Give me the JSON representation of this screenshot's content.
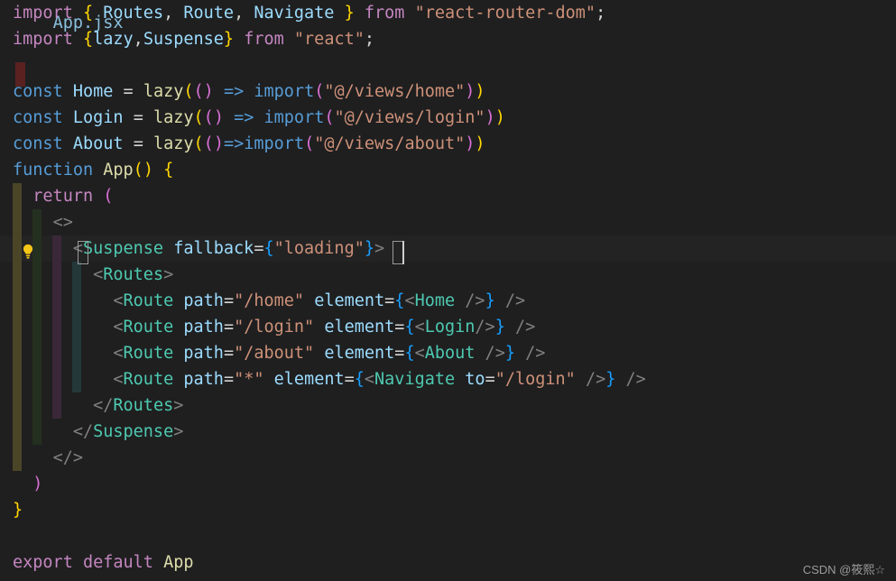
{
  "editor": {
    "language": "jsx",
    "theme": "dark-modern",
    "background_color": "#1f1f20",
    "current_line_color": "#232324",
    "cursor_line_index": 10,
    "cursor_column_after": ">"
  },
  "clipped_top_line": "App.jsx",
  "quickfix": {
    "icon": "lightbulb-icon",
    "title": "Show Code Actions",
    "line_index": 10
  },
  "code_lines": [
    {
      "index": 0,
      "indent": 0,
      "tokens": [
        {
          "t": "import",
          "c": "kw"
        },
        {
          "t": " ",
          "c": "punct"
        },
        {
          "t": "{",
          "c": "br1"
        },
        {
          "t": " ",
          "c": "punct"
        },
        {
          "t": "Routes",
          "c": "ident"
        },
        {
          "t": ",",
          "c": "punct"
        },
        {
          "t": " ",
          "c": "punct"
        },
        {
          "t": "Route",
          "c": "ident"
        },
        {
          "t": ",",
          "c": "punct"
        },
        {
          "t": " ",
          "c": "punct"
        },
        {
          "t": "Navigate",
          "c": "ident"
        },
        {
          "t": " ",
          "c": "punct"
        },
        {
          "t": "}",
          "c": "br1"
        },
        {
          "t": " ",
          "c": "punct"
        },
        {
          "t": "from",
          "c": "kw"
        },
        {
          "t": " ",
          "c": "punct"
        },
        {
          "t": "\"react-router-dom\"",
          "c": "str"
        },
        {
          "t": ";",
          "c": "punct"
        }
      ]
    },
    {
      "index": 1,
      "indent": 0,
      "tokens": [
        {
          "t": "import",
          "c": "kw"
        },
        {
          "t": " ",
          "c": "punct"
        },
        {
          "t": "{",
          "c": "br1"
        },
        {
          "t": "lazy",
          "c": "ident"
        },
        {
          "t": ",",
          "c": "punct"
        },
        {
          "t": "Suspense",
          "c": "ident"
        },
        {
          "t": "}",
          "c": "br1"
        },
        {
          "t": " ",
          "c": "punct"
        },
        {
          "t": "from",
          "c": "kw"
        },
        {
          "t": " ",
          "c": "punct"
        },
        {
          "t": "\"react\"",
          "c": "str"
        },
        {
          "t": ";",
          "c": "punct"
        }
      ]
    },
    {
      "index": 2,
      "indent": 0,
      "tokens": []
    },
    {
      "index": 3,
      "indent": 0,
      "tokens": [
        {
          "t": "const",
          "c": "kw2"
        },
        {
          "t": " ",
          "c": "punct"
        },
        {
          "t": "Home",
          "c": "ident"
        },
        {
          "t": " ",
          "c": "punct"
        },
        {
          "t": "=",
          "c": "op"
        },
        {
          "t": " ",
          "c": "punct"
        },
        {
          "t": "lazy",
          "c": "fn"
        },
        {
          "t": "(",
          "c": "br1"
        },
        {
          "t": "(",
          "c": "br2"
        },
        {
          "t": ")",
          "c": "br2"
        },
        {
          "t": " ",
          "c": "punct"
        },
        {
          "t": "=>",
          "c": "arrow"
        },
        {
          "t": " ",
          "c": "punct"
        },
        {
          "t": "import",
          "c": "arrow"
        },
        {
          "t": "(",
          "c": "br2"
        },
        {
          "t": "\"@/views/home\"",
          "c": "str"
        },
        {
          "t": ")",
          "c": "br2"
        },
        {
          "t": ")",
          "c": "br1"
        }
      ]
    },
    {
      "index": 4,
      "indent": 0,
      "tokens": [
        {
          "t": "const",
          "c": "kw2"
        },
        {
          "t": " ",
          "c": "punct"
        },
        {
          "t": "Login",
          "c": "ident"
        },
        {
          "t": " ",
          "c": "punct"
        },
        {
          "t": "=",
          "c": "op"
        },
        {
          "t": " ",
          "c": "punct"
        },
        {
          "t": "lazy",
          "c": "fn"
        },
        {
          "t": "(",
          "c": "br1"
        },
        {
          "t": "(",
          "c": "br2"
        },
        {
          "t": ")",
          "c": "br2"
        },
        {
          "t": " ",
          "c": "punct"
        },
        {
          "t": "=>",
          "c": "arrow"
        },
        {
          "t": " ",
          "c": "punct"
        },
        {
          "t": "import",
          "c": "arrow"
        },
        {
          "t": "(",
          "c": "br2"
        },
        {
          "t": "\"@/views/login\"",
          "c": "str"
        },
        {
          "t": ")",
          "c": "br2"
        },
        {
          "t": ")",
          "c": "br1"
        }
      ]
    },
    {
      "index": 5,
      "indent": 0,
      "tokens": [
        {
          "t": "const",
          "c": "kw2"
        },
        {
          "t": " ",
          "c": "punct"
        },
        {
          "t": "About",
          "c": "ident"
        },
        {
          "t": " ",
          "c": "punct"
        },
        {
          "t": "=",
          "c": "op"
        },
        {
          "t": " ",
          "c": "punct"
        },
        {
          "t": "lazy",
          "c": "fn"
        },
        {
          "t": "(",
          "c": "br1"
        },
        {
          "t": "(",
          "c": "br2"
        },
        {
          "t": ")",
          "c": "br2"
        },
        {
          "t": "=>",
          "c": "arrow"
        },
        {
          "t": "import",
          "c": "arrow"
        },
        {
          "t": "(",
          "c": "br2"
        },
        {
          "t": "\"@/views/about\"",
          "c": "str"
        },
        {
          "t": ")",
          "c": "br2"
        },
        {
          "t": ")",
          "c": "br1"
        }
      ]
    },
    {
      "index": 6,
      "indent": 0,
      "tokens": [
        {
          "t": "function",
          "c": "kw2"
        },
        {
          "t": " ",
          "c": "punct"
        },
        {
          "t": "App",
          "c": "fn"
        },
        {
          "t": "(",
          "c": "br1"
        },
        {
          "t": ")",
          "c": "br1"
        },
        {
          "t": " ",
          "c": "punct"
        },
        {
          "t": "{",
          "c": "br1"
        }
      ]
    },
    {
      "index": 7,
      "indent": 1,
      "tokens": [
        {
          "t": "return",
          "c": "kw"
        },
        {
          "t": " ",
          "c": "punct"
        },
        {
          "t": "(",
          "c": "br2"
        }
      ]
    },
    {
      "index": 8,
      "indent": 2,
      "tokens": [
        {
          "t": "<>",
          "c": "tagpunct"
        }
      ]
    },
    {
      "index": 9,
      "indent": 3,
      "tokens": [
        {
          "t": "<",
          "c": "tagpunct"
        },
        {
          "t": "Suspense",
          "c": "type"
        },
        {
          "t": " ",
          "c": "punct"
        },
        {
          "t": "fallback",
          "c": "attr"
        },
        {
          "t": "=",
          "c": "op"
        },
        {
          "t": "{",
          "c": "br3"
        },
        {
          "t": "\"loading\"",
          "c": "str"
        },
        {
          "t": "}",
          "c": "br3"
        },
        {
          "t": ">",
          "c": "tagpunct"
        }
      ]
    },
    {
      "index": 10,
      "indent": 4,
      "tokens": [
        {
          "t": "<",
          "c": "tagpunct"
        },
        {
          "t": "Routes",
          "c": "type"
        },
        {
          "t": ">",
          "c": "tagpunct"
        }
      ]
    },
    {
      "index": 11,
      "indent": 5,
      "tokens": [
        {
          "t": "<",
          "c": "tagpunct"
        },
        {
          "t": "Route",
          "c": "type"
        },
        {
          "t": " ",
          "c": "punct"
        },
        {
          "t": "path",
          "c": "attr"
        },
        {
          "t": "=",
          "c": "op"
        },
        {
          "t": "\"/home\"",
          "c": "str"
        },
        {
          "t": " ",
          "c": "punct"
        },
        {
          "t": "element",
          "c": "attr"
        },
        {
          "t": "=",
          "c": "op"
        },
        {
          "t": "{",
          "c": "br3"
        },
        {
          "t": "<",
          "c": "tagpunct"
        },
        {
          "t": "Home",
          "c": "type"
        },
        {
          "t": " />",
          "c": "tagpunct"
        },
        {
          "t": "}",
          "c": "br3"
        },
        {
          "t": " />",
          "c": "tagpunct"
        }
      ]
    },
    {
      "index": 12,
      "indent": 5,
      "tokens": [
        {
          "t": "<",
          "c": "tagpunct"
        },
        {
          "t": "Route",
          "c": "type"
        },
        {
          "t": " ",
          "c": "punct"
        },
        {
          "t": "path",
          "c": "attr"
        },
        {
          "t": "=",
          "c": "op"
        },
        {
          "t": "\"/login\"",
          "c": "str"
        },
        {
          "t": " ",
          "c": "punct"
        },
        {
          "t": "element",
          "c": "attr"
        },
        {
          "t": "=",
          "c": "op"
        },
        {
          "t": "{",
          "c": "br3"
        },
        {
          "t": "<",
          "c": "tagpunct"
        },
        {
          "t": "Login",
          "c": "type"
        },
        {
          "t": "/>",
          "c": "tagpunct"
        },
        {
          "t": "}",
          "c": "br3"
        },
        {
          "t": " />",
          "c": "tagpunct"
        }
      ]
    },
    {
      "index": 13,
      "indent": 5,
      "tokens": [
        {
          "t": "<",
          "c": "tagpunct"
        },
        {
          "t": "Route",
          "c": "type"
        },
        {
          "t": " ",
          "c": "punct"
        },
        {
          "t": "path",
          "c": "attr"
        },
        {
          "t": "=",
          "c": "op"
        },
        {
          "t": "\"/about\"",
          "c": "str"
        },
        {
          "t": " ",
          "c": "punct"
        },
        {
          "t": "element",
          "c": "attr"
        },
        {
          "t": "=",
          "c": "op"
        },
        {
          "t": "{",
          "c": "br3"
        },
        {
          "t": "<",
          "c": "tagpunct"
        },
        {
          "t": "About",
          "c": "type"
        },
        {
          "t": " />",
          "c": "tagpunct"
        },
        {
          "t": "}",
          "c": "br3"
        },
        {
          "t": " />",
          "c": "tagpunct"
        }
      ]
    },
    {
      "index": 14,
      "indent": 5,
      "tokens": [
        {
          "t": "<",
          "c": "tagpunct"
        },
        {
          "t": "Route",
          "c": "type"
        },
        {
          "t": " ",
          "c": "punct"
        },
        {
          "t": "path",
          "c": "attr"
        },
        {
          "t": "=",
          "c": "op"
        },
        {
          "t": "\"*\"",
          "c": "str"
        },
        {
          "t": " ",
          "c": "punct"
        },
        {
          "t": "element",
          "c": "attr"
        },
        {
          "t": "=",
          "c": "op"
        },
        {
          "t": "{",
          "c": "br3"
        },
        {
          "t": "<",
          "c": "tagpunct"
        },
        {
          "t": "Navigate",
          "c": "type"
        },
        {
          "t": " ",
          "c": "punct"
        },
        {
          "t": "to",
          "c": "attr"
        },
        {
          "t": "=",
          "c": "op"
        },
        {
          "t": "\"/login\"",
          "c": "str"
        },
        {
          "t": " />",
          "c": "tagpunct"
        },
        {
          "t": "}",
          "c": "br3"
        },
        {
          "t": " />",
          "c": "tagpunct"
        }
      ]
    },
    {
      "index": 15,
      "indent": 4,
      "tokens": [
        {
          "t": "</",
          "c": "tagpunct"
        },
        {
          "t": "Routes",
          "c": "type"
        },
        {
          "t": ">",
          "c": "tagpunct"
        }
      ]
    },
    {
      "index": 16,
      "indent": 3,
      "tokens": [
        {
          "t": "</",
          "c": "tagpunct"
        },
        {
          "t": "Suspense",
          "c": "type"
        },
        {
          "t": ">",
          "c": "tagpunct"
        }
      ]
    },
    {
      "index": 17,
      "indent": 2,
      "tokens": [
        {
          "t": "</>",
          "c": "tagpunct"
        }
      ]
    },
    {
      "index": 18,
      "indent": 1,
      "tokens": [
        {
          "t": ")",
          "c": "br2"
        }
      ]
    },
    {
      "index": 19,
      "indent": 0,
      "tokens": [
        {
          "t": "}",
          "c": "br1"
        }
      ]
    },
    {
      "index": 20,
      "indent": 0,
      "tokens": []
    },
    {
      "index": 21,
      "indent": 0,
      "tokens": [
        {
          "t": "export",
          "c": "kw"
        },
        {
          "t": " ",
          "c": "punct"
        },
        {
          "t": "default",
          "c": "kw"
        },
        {
          "t": " ",
          "c": "punct"
        },
        {
          "t": "App",
          "c": "fn"
        }
      ]
    }
  ],
  "watermark": {
    "text": "CSDN @筱熙☆"
  },
  "colors": {
    "background": "#1f1f20",
    "keyword_pink": "#C586C0",
    "keyword_blue": "#569CD6",
    "identifier": "#9CDCFE",
    "type_green": "#4EC9B0",
    "function_yellow": "#DCDCAA",
    "string_orange": "#CE9178",
    "bracket_yellow": "#FFD700",
    "bracket_magenta": "#DA70D6",
    "bracket_blue": "#179FFF",
    "tag_punct": "#808080",
    "guide_olive": "#4a4526",
    "guide_green": "#24301f",
    "guide_purple": "#3a2838",
    "guide_teal": "#24383a",
    "error_block": "#5a2121",
    "watermark": "#9b9b9b"
  }
}
